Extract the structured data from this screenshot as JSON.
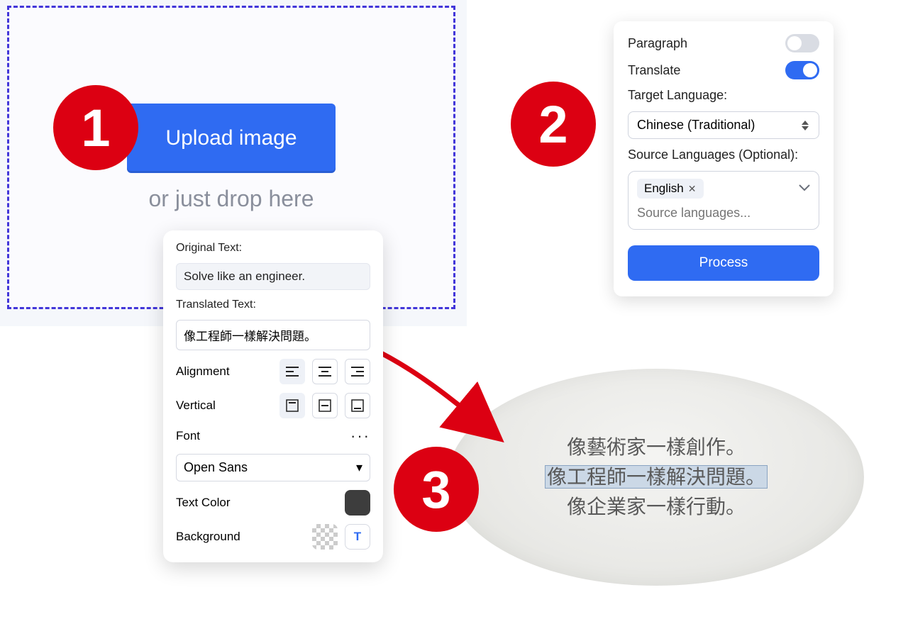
{
  "steps": {
    "one": "1",
    "two": "2",
    "three": "3"
  },
  "upload": {
    "button_label": "Upload image",
    "drop_hint": "or just drop here"
  },
  "settings": {
    "paragraph_label": "Paragraph",
    "paragraph_on": false,
    "translate_label": "Translate",
    "translate_on": true,
    "target_label": "Target Language:",
    "target_value": "Chinese (Traditional)",
    "source_label": "Source Languages (Optional):",
    "source_tag": "English",
    "source_placeholder": "Source languages...",
    "process_label": "Process"
  },
  "editor": {
    "original_label": "Original Text:",
    "original_value": "Solve like an engineer.",
    "translated_label": "Translated Text:",
    "translated_value": "像工程師一樣解決問題。",
    "alignment_label": "Alignment",
    "vertical_label": "Vertical",
    "font_label": "Font",
    "font_value": "Open Sans",
    "text_color_label": "Text Color",
    "background_label": "Background",
    "bg_button": "T",
    "text_color_value": "#3d3d3d"
  },
  "result": {
    "line1": "像藝術家一樣創作。",
    "line2": "像工程師一樣解決問題。",
    "line3": "像企業家一樣行動。"
  }
}
